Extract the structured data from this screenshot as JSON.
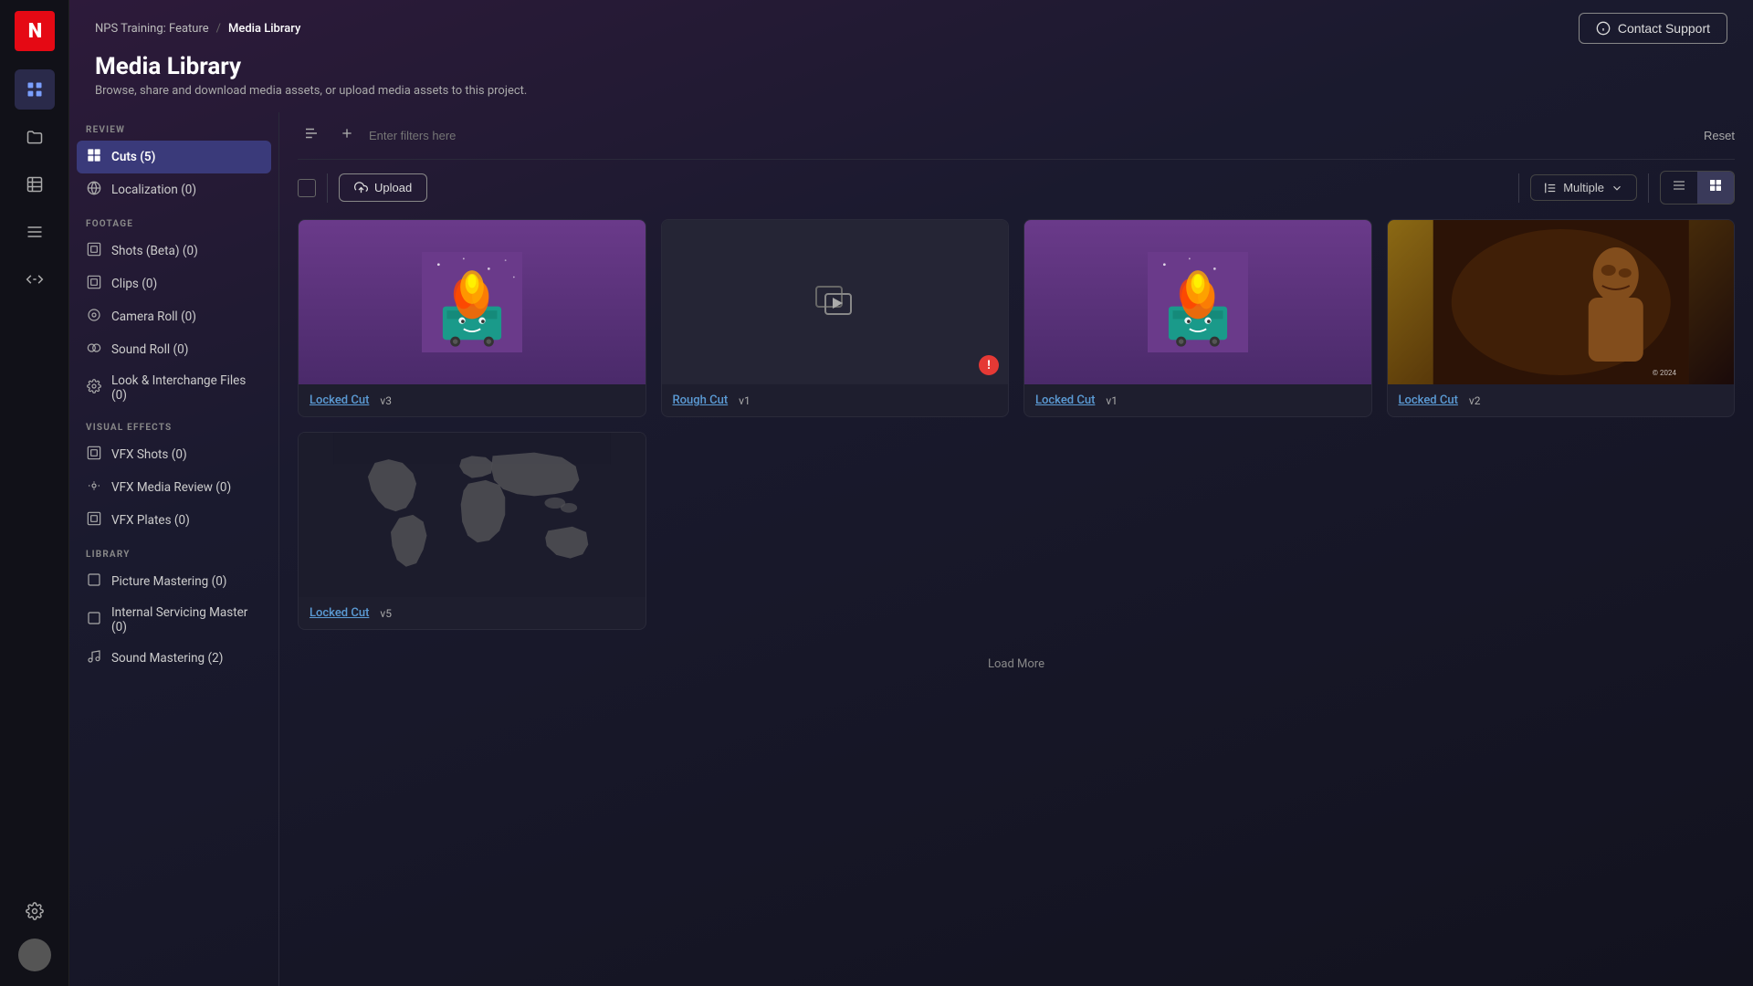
{
  "app": {
    "logo": "N"
  },
  "breadcrumb": {
    "parent": "NPS Training: Feature",
    "separator": "/",
    "current": "Media Library"
  },
  "header": {
    "contact_support_label": "Contact Support",
    "page_title": "Media Library",
    "page_subtitle": "Browse, share and download media assets, or upload media assets to this project."
  },
  "sidebar": {
    "review_label": "REVIEW",
    "footage_label": "FOOTAGE",
    "visual_effects_label": "VISUAL EFFECTS",
    "library_label": "LIBRARY",
    "review_items": [
      {
        "id": "cuts",
        "label": "Cuts (5)",
        "icon": "◈",
        "active": true
      },
      {
        "id": "localization",
        "label": "Localization (0)",
        "icon": "⊕"
      }
    ],
    "footage_items": [
      {
        "id": "shots-beta",
        "label": "Shots (Beta) (0)",
        "icon": "▦"
      },
      {
        "id": "clips",
        "label": "Clips (0)",
        "icon": "▦"
      },
      {
        "id": "camera-roll",
        "label": "Camera Roll (0)",
        "icon": "◎"
      },
      {
        "id": "sound-roll",
        "label": "Sound Roll (0)",
        "icon": "◎◎"
      },
      {
        "id": "look-interchange",
        "label": "Look & Interchange Files (0)",
        "icon": "⚙"
      }
    ],
    "vfx_items": [
      {
        "id": "vfx-shots",
        "label": "VFX Shots (0)",
        "icon": "▦"
      },
      {
        "id": "vfx-media-review",
        "label": "VFX Media Review (0)",
        "icon": "⚙"
      },
      {
        "id": "vfx-plates",
        "label": "VFX Plates (0)",
        "icon": "▦"
      }
    ],
    "library_items": [
      {
        "id": "picture-mastering",
        "label": "Picture Mastering (0)",
        "icon": "□"
      },
      {
        "id": "internal-servicing",
        "label": "Internal Servicing Master (0)",
        "icon": "□"
      },
      {
        "id": "sound-mastering",
        "label": "Sound Mastering (2)",
        "icon": ")"
      }
    ]
  },
  "toolbar": {
    "filter_placeholder": "Enter filters here",
    "reset_label": "Reset",
    "upload_label": "Upload",
    "sort_label": "Multiple",
    "load_more_label": "Load More"
  },
  "media_cards": [
    {
      "id": "card-1",
      "title": "Locked Cut",
      "version": "v3",
      "thumb_type": "dumpster",
      "error": false
    },
    {
      "id": "card-2",
      "title": "Rough Cut",
      "version": "v1",
      "thumb_type": "placeholder",
      "error": true
    },
    {
      "id": "card-3",
      "title": "Locked Cut",
      "version": "v1",
      "thumb_type": "dumpster",
      "error": false
    },
    {
      "id": "card-4",
      "title": "Locked Cut",
      "version": "v2",
      "thumb_type": "film",
      "error": false
    },
    {
      "id": "card-5",
      "title": "Locked Cut",
      "version": "v5",
      "thumb_type": "world",
      "error": false
    }
  ],
  "icons": {
    "left_nav_top": "⊞",
    "left_nav_folder": "⊟",
    "left_nav_grid": "⊞",
    "left_nav_table": "≡",
    "left_nav_keyframe": "⊣",
    "left_nav_settings": "⚙"
  }
}
